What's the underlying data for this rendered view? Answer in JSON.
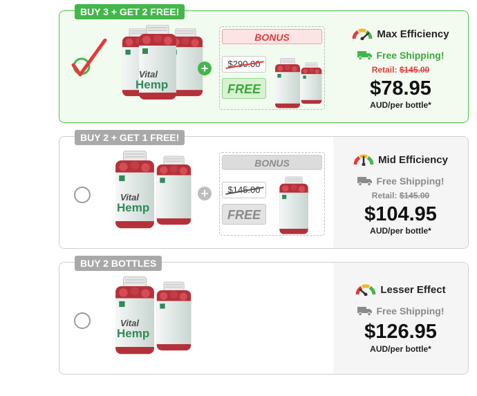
{
  "offers": [
    {
      "tag": "BUY 3 + GET 2 FREE!",
      "selected": true,
      "bonus_title": "BONUS",
      "bonus_old_price": "$290.00",
      "bonus_free": "FREE",
      "efficiency": "Max Efficiency",
      "shipping": "Free Shipping!",
      "retail_label": "Retail:",
      "retail_price": "$145.00",
      "price": "$78.95",
      "per_unit": "AUD/per bottle*",
      "product_name_line1": "Vital",
      "product_name_line2": "Hemp"
    },
    {
      "tag": "BUY 2 + GET 1 FREE!",
      "selected": false,
      "bonus_title": "BONUS",
      "bonus_old_price": "$145.00",
      "bonus_free": "FREE",
      "efficiency": "Mid Efficiency",
      "shipping": "Free Shipping!",
      "retail_label": "Retail:",
      "retail_price": "$145.00",
      "price": "$104.95",
      "per_unit": "AUD/per bottle*",
      "product_name_line1": "Vital",
      "product_name_line2": "Hemp"
    },
    {
      "tag": "BUY 2 BOTTLES",
      "selected": false,
      "efficiency": "Lesser Effect",
      "shipping": "Free Shipping!",
      "price": "$126.95",
      "per_unit": "AUD/per bottle*",
      "product_name_line1": "Vital",
      "product_name_line2": "Hemp"
    }
  ],
  "colors": {
    "accent_green": "#43b74a",
    "alert_red": "#e23b3b",
    "muted_gray": "#a9a9a9"
  },
  "icons": [
    "checkmark-icon",
    "plus-icon",
    "gauge-icon",
    "truck-icon",
    "bottle-image"
  ]
}
